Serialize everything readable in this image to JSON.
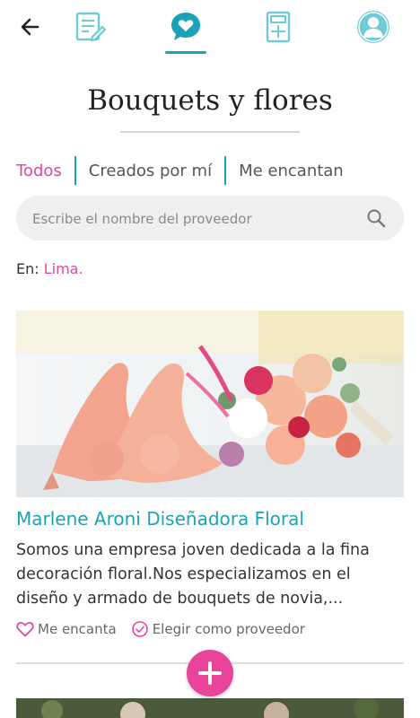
{
  "nav": {
    "icons": [
      "back-arrow-icon",
      "notes-icon",
      "heart-chat-icon",
      "calculator-icon",
      "profile-icon"
    ],
    "accent": "#1aa3b6"
  },
  "page": {
    "title": "Bouquets y flores"
  },
  "filters": {
    "all": "Todos",
    "mine": "Creados por mí",
    "liked": "Me encantan",
    "active": "Todos"
  },
  "search": {
    "placeholder": "Escribe el nombre del proveedor",
    "value": ""
  },
  "location": {
    "prefix": "En:",
    "city": "Lima."
  },
  "card": {
    "title": "Marlene Aroni Diseñadora Floral",
    "description": "Somos una empresa joven dedicada a la fina decoración floral.Nos especializamos en el diseño y armado de bouquets de novia,...",
    "like_label": "Me encanta",
    "choose_label": "Elegir como proveedor"
  },
  "colors": {
    "pink": "#e8449a",
    "teal": "#1aa3b6"
  }
}
